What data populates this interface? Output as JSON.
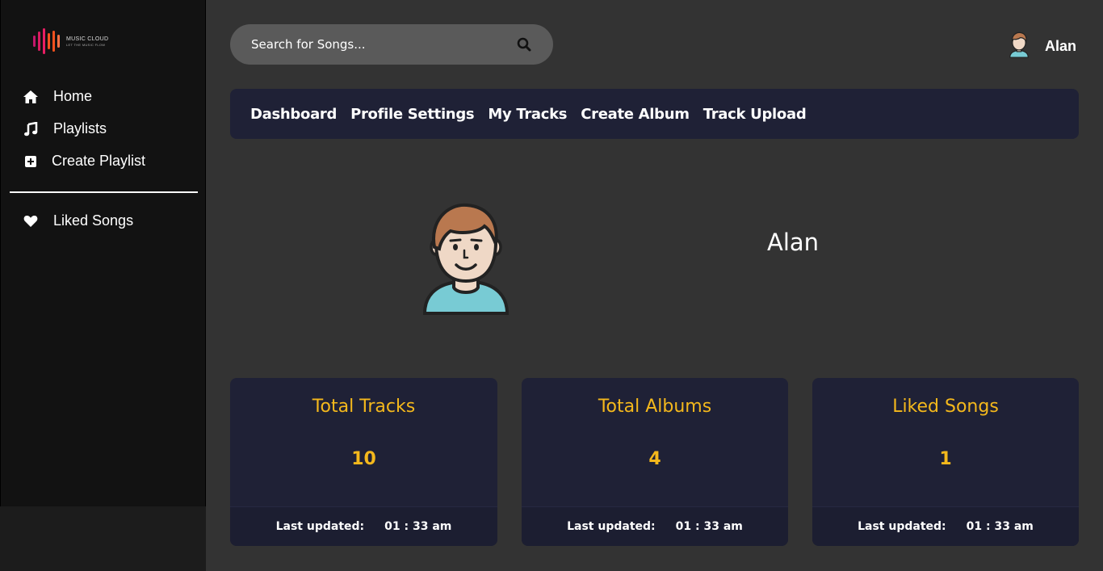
{
  "logo": {
    "title": "MUSIC CLOUD",
    "tagline": "LET THE MUSIC FLOW"
  },
  "sidebar": {
    "items": [
      {
        "label": "Home",
        "icon": "home-icon"
      },
      {
        "label": "Playlists",
        "icon": "music-note-icon"
      },
      {
        "label": "Create Playlist",
        "icon": "plus-square-icon"
      }
    ],
    "secondary": [
      {
        "label": "Liked Songs",
        "icon": "heart-icon"
      }
    ]
  },
  "search": {
    "placeholder": "Search for Songs..."
  },
  "user": {
    "name": "Alan"
  },
  "tabs": [
    "Dashboard",
    "Profile Settings",
    "My Tracks",
    "Create Album",
    "Track Upload"
  ],
  "profile": {
    "name": "Alan"
  },
  "stats": [
    {
      "title": "Total Tracks",
      "value": "10",
      "updated_label": "Last updated:",
      "updated_time": "01 : 33 am"
    },
    {
      "title": "Total Albums",
      "value": "4",
      "updated_label": "Last updated:",
      "updated_time": "01 : 33 am"
    },
    {
      "title": "Liked Songs",
      "value": "1",
      "updated_label": "Last updated:",
      "updated_time": "01 : 33 am"
    }
  ],
  "colors": {
    "accent": "#f4b81c",
    "panel": "#1f2136",
    "background": "#333333",
    "sidebar": "#121212"
  }
}
